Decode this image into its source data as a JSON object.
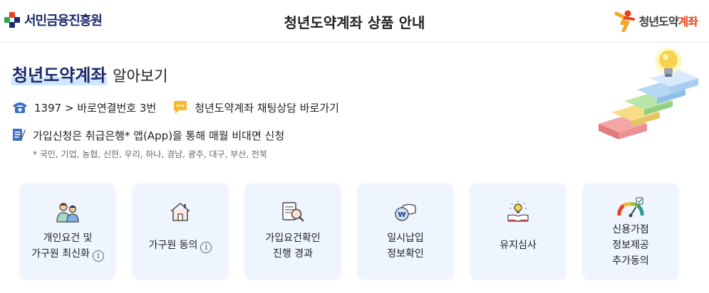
{
  "header": {
    "left_logo_text": "서민금융진흥원",
    "title": "청년도약계좌 상품 안내",
    "right_logo_text_a": "청년도약",
    "right_logo_text_b": "계좌"
  },
  "intro": {
    "title_highlight": "청년도약계좌",
    "title_rest": "알아보기",
    "phone_text": "1397 > 바로연결번호 3번",
    "chat_text": "청년도약계좌 채팅상담 바로가기",
    "apply_text": "가입신청은 취급은행* 앱(App)을 통해 매월 비대면 신청",
    "apply_note": "* 국민, 기업, 농협, 신한, 우리, 하나, 경남, 광주, 대구, 부산, 전북"
  },
  "cards": [
    {
      "line1": "개인요건 및",
      "line2": "가구원 최신화",
      "info": "i"
    },
    {
      "line1": "가구원 동의",
      "info": "i"
    },
    {
      "line1": "가입요건확인",
      "line2": "진행 경과"
    },
    {
      "line1": "일시납입",
      "line2": "정보확인"
    },
    {
      "line1": "유지심사"
    },
    {
      "line1": "신용가점",
      "line2": "정보제공",
      "line3": "추가동의"
    }
  ],
  "colors": {
    "brand_navy": "#1c2a6b",
    "accent_orange": "#e8411b",
    "card_bg": "#eef5ff"
  }
}
